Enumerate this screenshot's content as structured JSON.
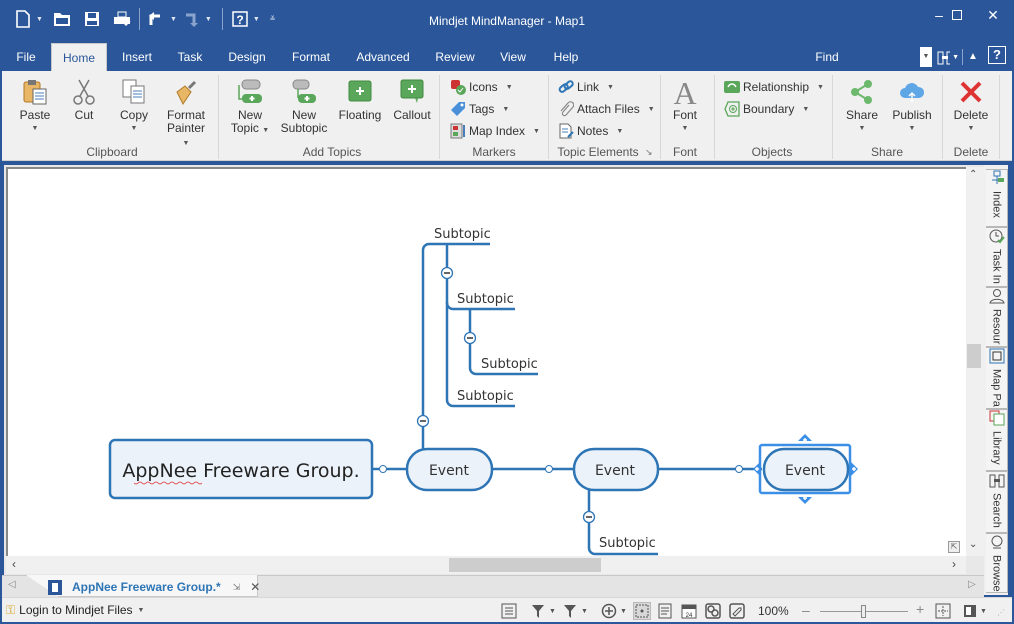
{
  "window": {
    "title": "Mindjet MindManager - Map1",
    "controls": {
      "minimize": "minimize-icon",
      "maximize": "maximize-icon",
      "close": "close-icon"
    }
  },
  "quick_access": [
    "new-document-icon",
    "open-icon",
    "save-icon",
    "print-icon",
    "undo-icon",
    "redo-icon",
    "help-icon",
    "customize-icon"
  ],
  "tabs": [
    {
      "label": "File",
      "active": false
    },
    {
      "label": "Home",
      "active": true
    },
    {
      "label": "Insert",
      "active": false
    },
    {
      "label": "Task",
      "active": false
    },
    {
      "label": "Design",
      "active": false
    },
    {
      "label": "Format",
      "active": false
    },
    {
      "label": "Advanced",
      "active": false
    },
    {
      "label": "Review",
      "active": false
    },
    {
      "label": "View",
      "active": false
    },
    {
      "label": "Help",
      "active": false
    }
  ],
  "find": {
    "label": "Find"
  },
  "ribbon": {
    "clipboard": {
      "group": "Clipboard",
      "paste": "Paste",
      "cut": "Cut",
      "copy": "Copy",
      "format_painter_1": "Format",
      "format_painter_2": "Painter"
    },
    "add_topics": {
      "group": "Add Topics",
      "new_topic_1": "New",
      "new_topic_2": "Topic",
      "new_subtopic_1": "New",
      "new_subtopic_2": "Subtopic",
      "floating": "Floating",
      "callout": "Callout"
    },
    "markers": {
      "group": "Markers",
      "icons": "Icons",
      "tags": "Tags",
      "map_index": "Map Index"
    },
    "topic_elements": {
      "group": "Topic Elements",
      "link": "Link",
      "attach_files": "Attach Files",
      "notes": "Notes"
    },
    "font": {
      "group": "Font",
      "font": "Font"
    },
    "objects": {
      "group": "Objects",
      "relationship": "Relationship",
      "boundary": "Boundary"
    },
    "share": {
      "group": "Share",
      "share": "Share",
      "publish": "Publish"
    },
    "delete": {
      "group": "Delete",
      "delete": "Delete"
    }
  },
  "map": {
    "central_topic": "AppNee Freeware Group.",
    "events": [
      "Event",
      "Event",
      "Event"
    ],
    "subtopics": [
      "Subtopic",
      "Subtopic",
      "Subtopic",
      "Subtopic",
      "Subtopic"
    ],
    "accent": "#2e75b6",
    "topic_fill": "#ebf2fa",
    "selection": "#3c8fe6"
  },
  "side_panel": [
    "Index",
    "Task In",
    "Resour",
    "Map Pa",
    "Library",
    "Search",
    "Browse"
  ],
  "document_tab": {
    "label": "AppNee Freeware Group.*"
  },
  "status": {
    "login": "Login to Mindjet Files",
    "zoom": "100%",
    "zoom_slider_value": 0.5
  }
}
